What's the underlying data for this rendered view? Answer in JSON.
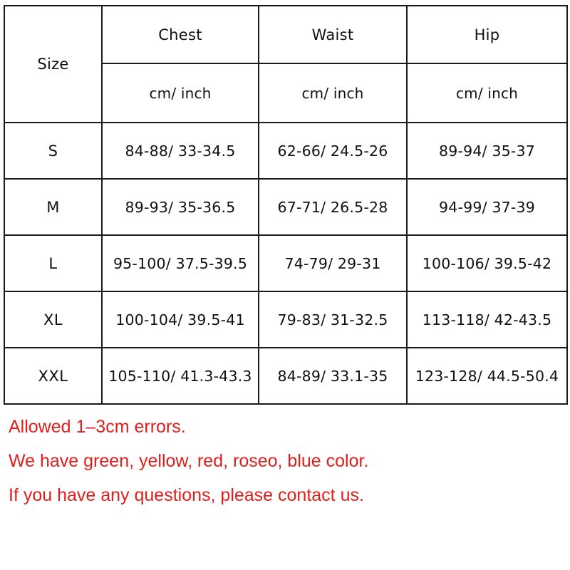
{
  "table": {
    "size_header": "Size",
    "measurement_headers": [
      "Chest",
      "Waist",
      "Hip"
    ],
    "unit_label": "cm/ inch",
    "unit_row": [
      "cm/ inch",
      "cm/ inch",
      "cm/ inch"
    ],
    "rows": [
      {
        "size": "S",
        "chest": "84-88/ 33-34.5",
        "waist": "62-66/ 24.5-26",
        "hip": "89-94/ 35-37"
      },
      {
        "size": "M",
        "chest": "89-93/ 35-36.5",
        "waist": "67-71/ 26.5-28",
        "hip": "94-99/ 37-39"
      },
      {
        "size": "L",
        "chest": "95-100/ 37.5-39.5",
        "waist": "74-79/ 29-31",
        "hip": "100-106/ 39.5-42"
      },
      {
        "size": "XL",
        "chest": "100-104/ 39.5-41",
        "waist": "79-83/ 31-32.5",
        "hip": "113-118/ 42-43.5"
      },
      {
        "size": "XXL",
        "chest": "105-110/ 41.3-43.3",
        "waist": "84-89/ 33.1-35",
        "hip": "123-128/ 44.5-50.4"
      }
    ]
  },
  "notes": {
    "lines": [
      "Allowed 1–3cm errors.",
      "We have green, yellow, red, roseo, blue color.",
      "If you have any questions, please contact us."
    ],
    "color": "#e01f1c"
  },
  "colors": {
    "background": "#ffffff",
    "border": "#1a1a1a",
    "text": "#111111",
    "note_red": "#e01f1c"
  }
}
